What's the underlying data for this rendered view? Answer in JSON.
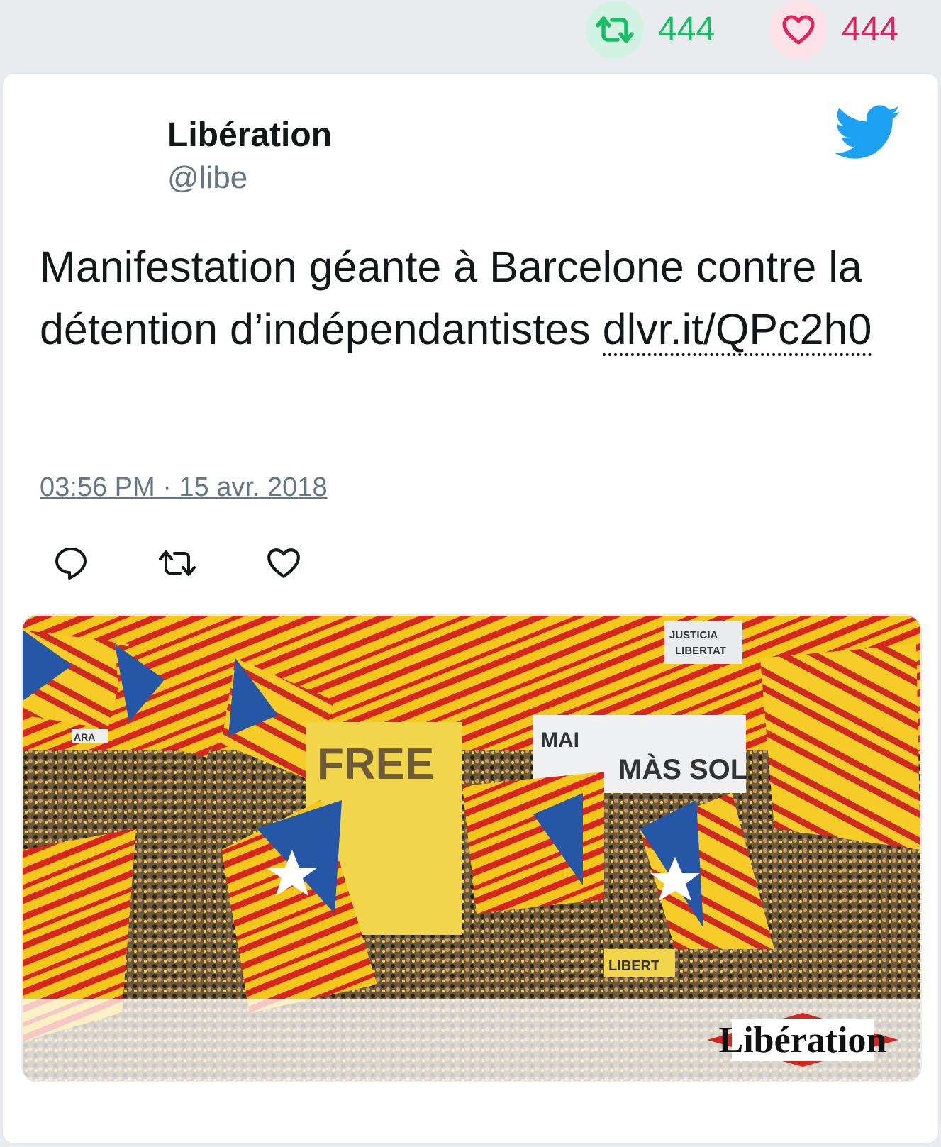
{
  "stats": {
    "retweets": "444",
    "likes": "444"
  },
  "author": {
    "name": "Libération",
    "handle": "@libe"
  },
  "tweet": {
    "text": "Manifestation géante à Barcelone contre la détention d’indépendantistes ",
    "link": "dlvr.it/QPc2h0",
    "timestamp": "03:56 PM · 15 avr. 2018"
  },
  "media": {
    "logo_text": "Libération",
    "banner_texts": [
      "FREE",
      "MAI",
      "MÀS SOL",
      "JUSTICIA",
      "LIBERTAT",
      "LIBERT",
      "ARA"
    ]
  },
  "icons": {
    "retweet_stat": "retweet-icon",
    "like_stat": "heart-icon",
    "twitter": "twitter-bird-icon",
    "reply": "reply-icon",
    "retweet": "retweet-icon",
    "like": "heart-icon"
  },
  "colors": {
    "retweet_green": "#17bf63",
    "like_red": "#e0245e",
    "twitter_blue": "#1da1f2",
    "muted_gray": "#657786"
  }
}
